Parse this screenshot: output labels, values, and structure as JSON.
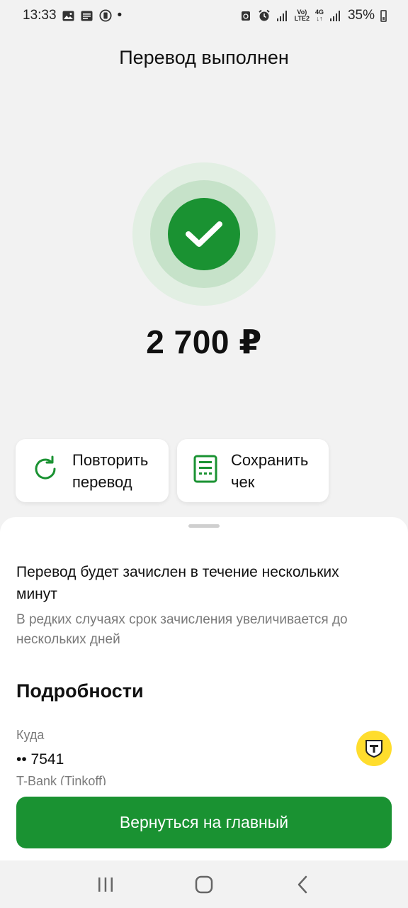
{
  "status_bar": {
    "time": "13:33",
    "left_icons": [
      "image-icon",
      "message-icon",
      "sim-icon"
    ],
    "dot": "•",
    "network_top": "Vo)",
    "network_bottom": "LTE2",
    "network_gen": "4G",
    "battery": "35%"
  },
  "header": {
    "title": "Перевод выполнен"
  },
  "result": {
    "amount": "2 700 ₽",
    "status_icon": "check-icon",
    "accent_color": "#1a9232"
  },
  "actions": {
    "repeat": {
      "line1": "Повторить",
      "line2": "перевод",
      "icon": "refresh-icon"
    },
    "receipt": {
      "line1": "Сохранить",
      "line2": "чек",
      "icon": "receipt-icon"
    }
  },
  "sheet": {
    "info_title": "Перевод будет зачислен в течение нескольких минут",
    "info_subtitle": "В редких случаях срок зачисления увеличивается до нескольких дней",
    "details_heading": "Подробности",
    "destination_label": "Куда",
    "destination_number": "•• 7541",
    "destination_bank": "T-Bank (Tinkoff)",
    "bank_logo_letter": "Т",
    "bank_logo_color": "#ffdd2d"
  },
  "main_button": {
    "label": "Вернуться на главный"
  },
  "nav": {
    "items": [
      "recent-apps-icon",
      "home-icon",
      "back-icon"
    ]
  }
}
